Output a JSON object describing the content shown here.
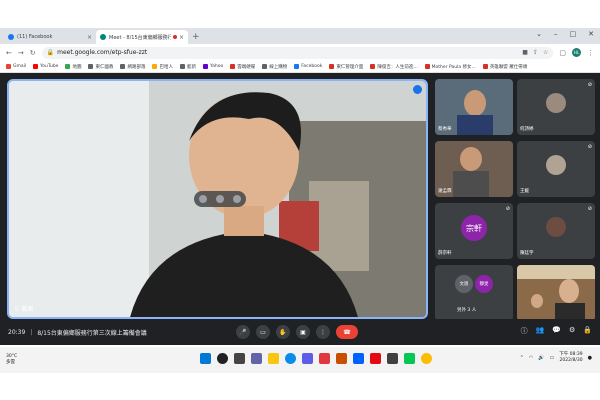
{
  "browser": {
    "tabs": [
      {
        "title": "(11) Facebook",
        "favicon_color": "#1877f2",
        "active": false
      },
      {
        "title": "Meet - 8/15台東偏鄉服務行第...",
        "favicon_color": "#00897b",
        "active": true
      }
    ],
    "new_tab": "+",
    "url": "meet.google.com/etp-sfue-zzt",
    "profile_initial": "HL",
    "bookmarks": [
      {
        "label": "Gmail",
        "color": "#ea4335"
      },
      {
        "label": "YouTube",
        "color": "#ff0000"
      },
      {
        "label": "地圖",
        "color": "#34a853"
      },
      {
        "label": "東仁國教",
        "color": "#5f6368"
      },
      {
        "label": "網路部落",
        "color": "#5f6368"
      },
      {
        "label": "巴哈人",
        "color": "#f9ab00"
      },
      {
        "label": "藍新",
        "color": "#5f6368"
      },
      {
        "label": "Yahoo",
        "color": "#6001d2"
      },
      {
        "label": "雲端硬碟",
        "color": "#d93025"
      },
      {
        "label": "線上購物",
        "color": "#5f6368"
      },
      {
        "label": "Facebook",
        "color": "#1877f2"
      },
      {
        "label": "東仁管理介面",
        "color": "#d93025"
      },
      {
        "label": "陳俊吉：人生前進...",
        "color": "#d93025"
      },
      {
        "label": "Mother Paula 修女...",
        "color": "#d93025"
      },
      {
        "label": "英雄聯盟 羅仕帶頭",
        "color": "#d93025"
      }
    ]
  },
  "meet": {
    "main_speaker": {
      "name": "劉君",
      "mute_icon": "mic-off-icon"
    },
    "tiles": [
      {
        "name": "蔡秀華",
        "type": "camera"
      },
      {
        "name": "何詩婷",
        "type": "avatar"
      },
      {
        "name": "謝孟霖",
        "type": "camera"
      },
      {
        "name": "王媛",
        "type": "avatar"
      },
      {
        "name": "薛宗軒",
        "type": "text-avatar",
        "avatar_text": "宗軒"
      },
      {
        "name": "陳廷宇",
        "type": "avatar"
      },
      {
        "name": "另外 3 人",
        "type": "others",
        "avatars": [
          "文恩",
          "靜旻"
        ]
      },
      {
        "name": "",
        "type": "camera"
      }
    ],
    "time": "20:39",
    "separator": "|",
    "meeting_title": "8/15台東偏鄉服務行第三次線上籌備會議"
  },
  "taskbar": {
    "weather_temp": "30°C",
    "weather_desc": "多雲",
    "clock_time": "下午 08:39",
    "clock_date": "2022/8/30"
  },
  "colors": {
    "meet_bg": "#202124",
    "active_border": "#8ab4f8",
    "end_call": "#ea4335"
  }
}
